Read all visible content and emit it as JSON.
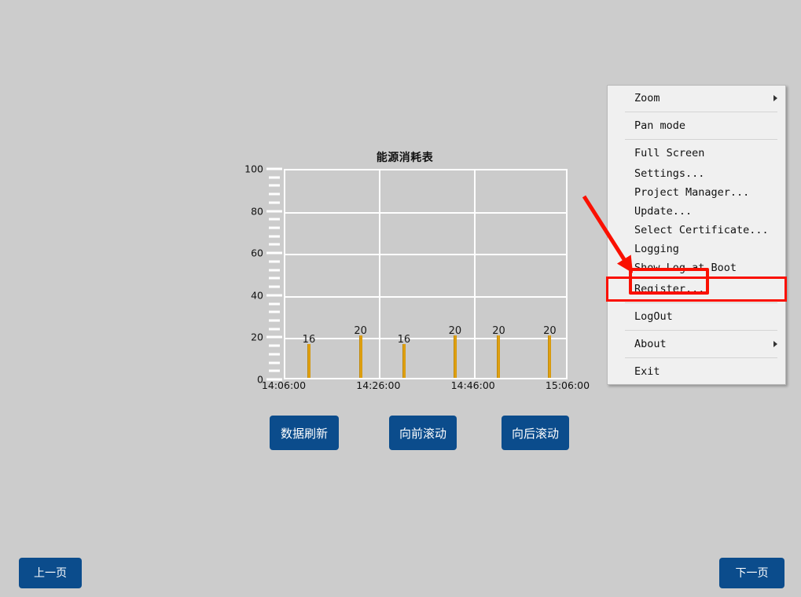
{
  "chart": {
    "title": "能源消耗表",
    "y_labels": [
      "100",
      "80",
      "60",
      "40",
      "20",
      "0"
    ],
    "x_labels": [
      "14:06:00",
      "14:26:00",
      "14:46:00",
      "15:06:00"
    ],
    "bar_labels": [
      "16",
      "20",
      "16",
      "20",
      "20",
      "20"
    ]
  },
  "chart_data": {
    "type": "bar",
    "title": "能源消耗表",
    "xlabel": "",
    "ylabel": "",
    "ylim": [
      0,
      100
    ],
    "xlim": [
      "14:06:00",
      "15:06:00"
    ],
    "grid": true,
    "legend": "none",
    "y_ticks": [
      0,
      20,
      40,
      60,
      80,
      100
    ],
    "y_minor_ticks_between": 4,
    "x_ticks": [
      "14:06:00",
      "14:26:00",
      "14:46:00",
      "15:06:00"
    ],
    "categories": [
      "14:08:00",
      "14:21:00",
      "14:28:00",
      "14:41:00",
      "14:48:00",
      "15:01:00"
    ],
    "values": [
      16,
      20,
      16,
      20,
      20,
      20
    ],
    "bar_color": "#d9960c",
    "plot_background": "#cbcbcb",
    "grid_color": "#ffffff"
  },
  "buttons": {
    "refresh": "数据刷新",
    "scroll_forward": "向前滚动",
    "scroll_backward": "向后滚动",
    "prev_page": "上一页",
    "next_page": "下一页"
  },
  "context_menu": {
    "items": [
      {
        "label": "Zoom",
        "submenu": true
      },
      {
        "label": "Pan mode",
        "submenu": false
      },
      {
        "label": "Full Screen",
        "submenu": false
      },
      {
        "label": "Settings...",
        "submenu": false
      },
      {
        "label": "Project Manager...",
        "submenu": false
      },
      {
        "label": "Update...",
        "submenu": false
      },
      {
        "label": "Select Certificate...",
        "submenu": false
      },
      {
        "label": "Logging",
        "submenu": false
      },
      {
        "label": "Show Log at Boot",
        "submenu": false
      },
      {
        "label": "Register...",
        "submenu": false
      },
      {
        "label": "LogOut",
        "submenu": false
      },
      {
        "label": "About",
        "submenu": true
      },
      {
        "label": "Exit",
        "submenu": false
      }
    ],
    "highlighted_item": "Register..."
  },
  "annotation": {
    "arrow_color": "#fa1000",
    "highlight_color": "#fa1000"
  },
  "colors": {
    "page_background": "#cccccc",
    "button_blue": "#0b4c8c",
    "menu_background": "#f0f0f0",
    "bar_orange": "#d9960c"
  }
}
